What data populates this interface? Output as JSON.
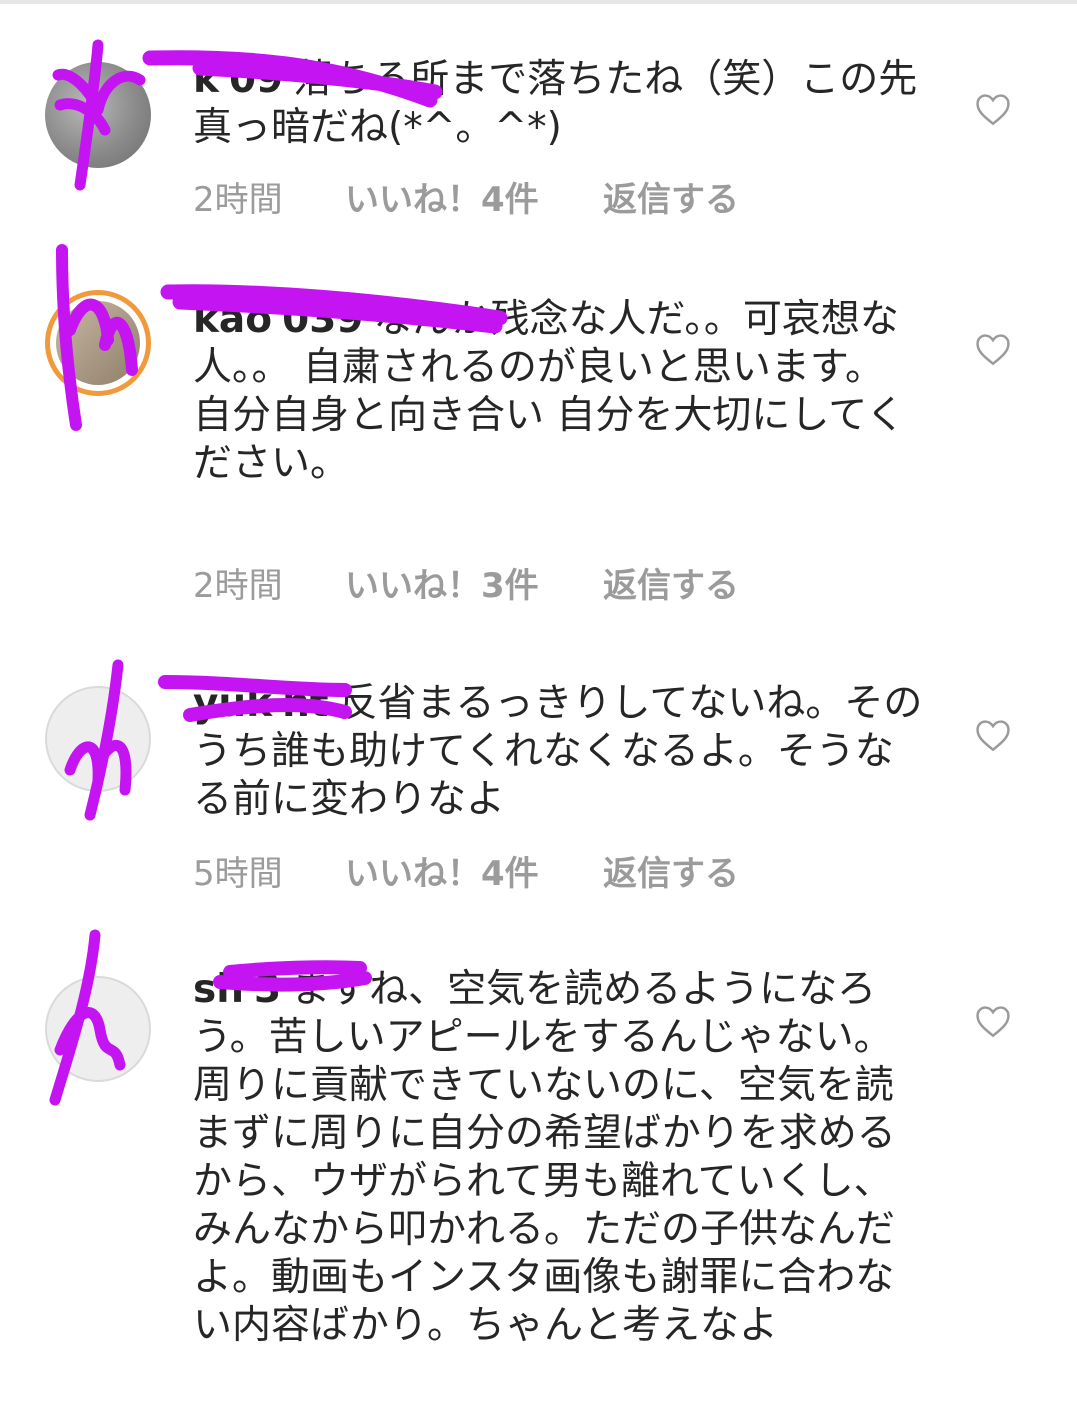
{
  "comments": [
    {
      "username": "k",
      "suffix": "09",
      "text": "落ちる所まで落ちたね（笑）この先真っ暗だね(*^。^*)",
      "time": "2時間",
      "likes": "いいね！4件",
      "reply": "返信する"
    },
    {
      "username": "kao",
      "suffix": "039",
      "text": "なんか残念な人だ。。可哀想な人。。 自粛されるのが良いと思います。\n自分自身と向き合い 自分を大切にしてください。",
      "time": "2時間",
      "likes": "いいね！3件",
      "reply": "返信する"
    },
    {
      "username": "yuk",
      "suffix": "nt",
      "text": "反省まるっきりしてないね。そのうち誰も助けてくれなくなるよ。そうなる前に変わりなよ",
      "time": "5時間",
      "likes": "いいね！4件",
      "reply": "返信する"
    },
    {
      "username": "sh",
      "suffix": "3",
      "text": "まずね、空気を読めるようになろう。苦しいアピールをするんじゃない。周りに貢献できていないのに、空気を読まずに周りに自分の希望ばかりを求めるから、ウザがられて男も離れていくし、みんなから叩かれる。ただの子供なんだよ。動画もインスタ画像も謝罪に合わない内容ばかり。ちゃんと考えなよ",
      "time": "",
      "likes": "",
      "reply": ""
    }
  ],
  "colors": {
    "scribble": "#c414f2",
    "meta": "#9b9b9b",
    "story_ring": "#f19a3b"
  },
  "icons": [
    "heart-outline-icon",
    "avatar"
  ]
}
